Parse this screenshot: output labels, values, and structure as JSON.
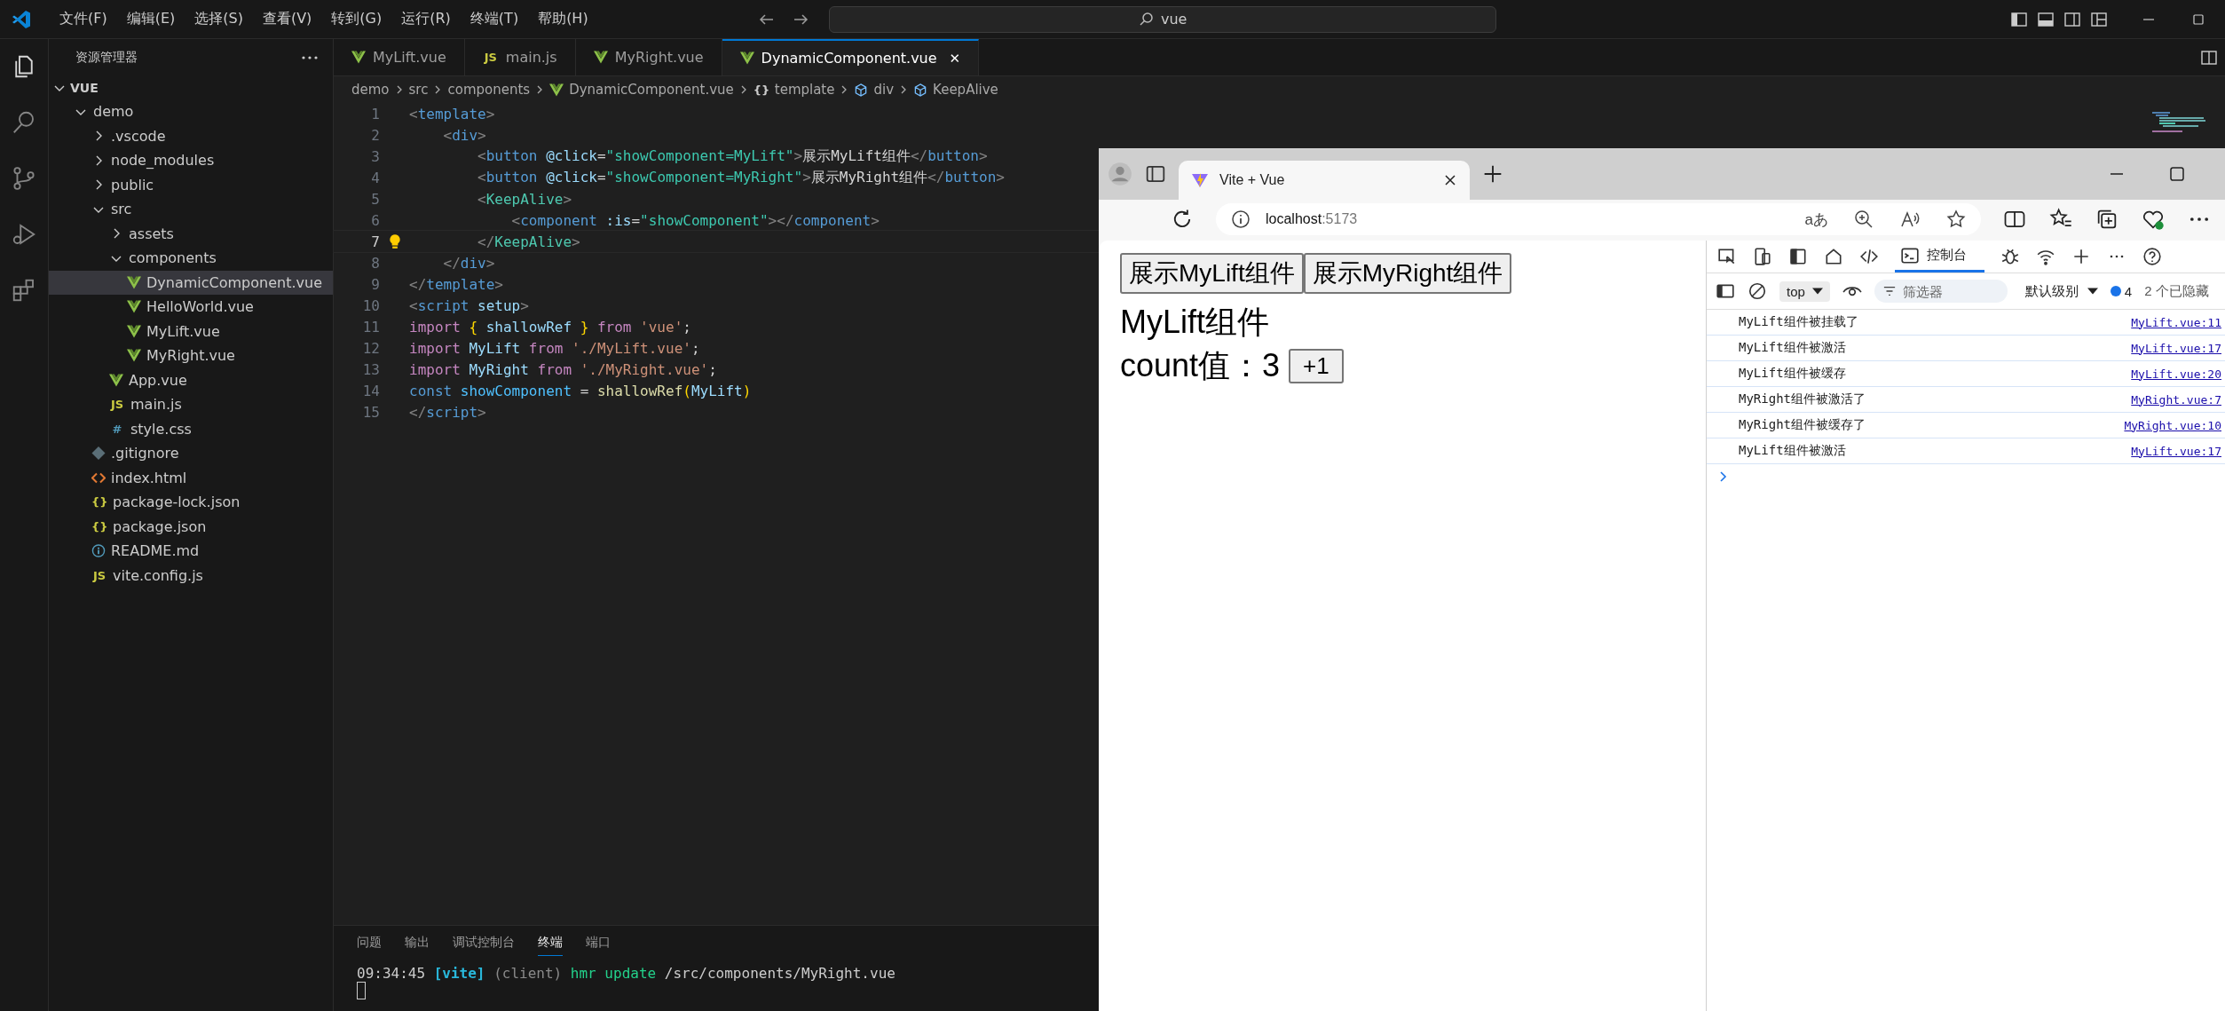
{
  "menu": [
    "文件(F)",
    "编辑(E)",
    "选择(S)",
    "查看(V)",
    "转到(G)",
    "运行(R)",
    "终端(T)",
    "帮助(H)"
  ],
  "command_center": {
    "value": "vue"
  },
  "activity_bar": [
    {
      "kind": "files",
      "selected": true
    },
    {
      "kind": "search",
      "selected": false
    },
    {
      "kind": "source-control",
      "selected": false
    },
    {
      "kind": "debug",
      "selected": false
    },
    {
      "kind": "extensions",
      "selected": false
    }
  ],
  "sidebar": {
    "title": "资源管理器",
    "root": "VUE",
    "tree": [
      {
        "label": "demo",
        "kind": "folder",
        "expanded": true,
        "selected": false,
        "children": [
          {
            "label": ".vscode",
            "kind": "folder",
            "expanded": false,
            "selected": false
          },
          {
            "label": "node_modules",
            "kind": "folder",
            "expanded": false,
            "selected": false
          },
          {
            "label": "public",
            "kind": "folder",
            "expanded": false,
            "selected": false
          },
          {
            "label": "src",
            "kind": "folder",
            "expanded": true,
            "selected": false,
            "children": [
              {
                "label": "assets",
                "kind": "folder",
                "expanded": false,
                "selected": false
              },
              {
                "label": "components",
                "kind": "folder",
                "expanded": true,
                "selected": false,
                "children": [
                  {
                    "label": "DynamicComponent.vue",
                    "kind": "vue",
                    "selected": true
                  },
                  {
                    "label": "HelloWorld.vue",
                    "kind": "vue",
                    "selected": false
                  },
                  {
                    "label": "MyLift.vue",
                    "kind": "vue",
                    "selected": false
                  },
                  {
                    "label": "MyRight.vue",
                    "kind": "vue",
                    "selected": false
                  }
                ]
              },
              {
                "label": "App.vue",
                "kind": "vue",
                "selected": false
              },
              {
                "label": "main.js",
                "kind": "js",
                "badge": "JS",
                "selected": false
              },
              {
                "label": "style.css",
                "kind": "css",
                "badge": "#",
                "selected": false
              }
            ]
          },
          {
            "label": ".gitignore",
            "kind": "git",
            "selected": false
          },
          {
            "label": "index.html",
            "kind": "html",
            "selected": false
          },
          {
            "label": "package-lock.json",
            "kind": "json",
            "badge": "{}",
            "selected": false
          },
          {
            "label": "package.json",
            "kind": "json",
            "badge": "{}",
            "selected": false
          },
          {
            "label": "README.md",
            "kind": "info",
            "selected": false
          },
          {
            "label": "vite.config.js",
            "kind": "js",
            "badge": "JS",
            "selected": false
          }
        ]
      }
    ]
  },
  "tabs": [
    {
      "label": "MyLift.vue",
      "kind": "vue",
      "selected": false
    },
    {
      "label": "main.js",
      "kind": "js",
      "badge": "JS",
      "selected": false
    },
    {
      "label": "MyRight.vue",
      "kind": "vue",
      "selected": false
    },
    {
      "label": "DynamicComponent.vue",
      "kind": "vue",
      "selected": true,
      "close": "✕"
    }
  ],
  "breadcrumb": [
    {
      "label": "demo",
      "kind": "text"
    },
    {
      "label": "src",
      "kind": "text"
    },
    {
      "label": "components",
      "kind": "text"
    },
    {
      "label": "DynamicComponent.vue",
      "kind": "vue"
    },
    {
      "label": "template",
      "kind": "object",
      "badge": "{}"
    },
    {
      "label": "div",
      "kind": "cube"
    },
    {
      "label": "KeepAlive",
      "kind": "cube"
    }
  ],
  "code": [
    {
      "number": "1",
      "current": false,
      "tokens": [
        {
          "kind": "p",
          "text": "<"
        },
        {
          "kind": "tag",
          "text": "template"
        },
        {
          "kind": "p",
          "text": ">"
        }
      ]
    },
    {
      "number": "2",
      "current": false,
      "tokens": [
        {
          "kind": "p",
          "text": "    <"
        },
        {
          "kind": "tag",
          "text": "div"
        },
        {
          "kind": "p",
          "text": ">"
        }
      ]
    },
    {
      "number": "3",
      "current": false,
      "tokens": [
        {
          "kind": "p",
          "text": "        <"
        },
        {
          "kind": "tag",
          "text": "button"
        },
        {
          "kind": "attr",
          "text": " @click"
        },
        {
          "kind": "plain",
          "text": "="
        },
        {
          "kind": "expr",
          "text": "\"showComponent=MyLift\""
        },
        {
          "kind": "p",
          "text": ">"
        },
        {
          "kind": "plain",
          "text": "展示MyLift组件"
        },
        {
          "kind": "p",
          "text": "</"
        },
        {
          "kind": "tag",
          "text": "button"
        },
        {
          "kind": "p",
          "text": ">"
        }
      ]
    },
    {
      "number": "4",
      "current": false,
      "tokens": [
        {
          "kind": "p",
          "text": "        <"
        },
        {
          "kind": "tag",
          "text": "button"
        },
        {
          "kind": "attr",
          "text": " @click"
        },
        {
          "kind": "plain",
          "text": "="
        },
        {
          "kind": "expr",
          "text": "\"showComponent=MyRight\""
        },
        {
          "kind": "p",
          "text": ">"
        },
        {
          "kind": "plain",
          "text": "展示MyRight组件"
        },
        {
          "kind": "p",
          "text": "</"
        },
        {
          "kind": "tag",
          "text": "button"
        },
        {
          "kind": "p",
          "text": ">"
        }
      ]
    },
    {
      "number": "5",
      "current": false,
      "tokens": [
        {
          "kind": "p",
          "text": "        <"
        },
        {
          "kind": "comp",
          "text": "KeepAlive"
        },
        {
          "kind": "p",
          "text": ">"
        }
      ]
    },
    {
      "number": "6",
      "current": false,
      "tokens": [
        {
          "kind": "p",
          "text": "            <"
        },
        {
          "kind": "tag",
          "text": "component"
        },
        {
          "kind": "attr",
          "text": " :is"
        },
        {
          "kind": "plain",
          "text": "="
        },
        {
          "kind": "expr",
          "text": "\"showComponent\""
        },
        {
          "kind": "p",
          "text": "></"
        },
        {
          "kind": "tag",
          "text": "component"
        },
        {
          "kind": "p",
          "text": ">"
        }
      ]
    },
    {
      "number": "7",
      "current": true,
      "tokens": [
        {
          "kind": "p",
          "text": "        </"
        },
        {
          "kind": "comp",
          "text": "KeepAlive"
        },
        {
          "kind": "p",
          "text": ">"
        }
      ]
    },
    {
      "number": "8",
      "current": false,
      "tokens": [
        {
          "kind": "p",
          "text": "    </"
        },
        {
          "kind": "tag",
          "text": "div"
        },
        {
          "kind": "p",
          "text": ">"
        }
      ]
    },
    {
      "number": "9",
      "current": false,
      "tokens": [
        {
          "kind": "p",
          "text": "</"
        },
        {
          "kind": "tag",
          "text": "template"
        },
        {
          "kind": "p",
          "text": ">"
        }
      ]
    },
    {
      "number": "10",
      "current": false,
      "tokens": [
        {
          "kind": "p",
          "text": "<"
        },
        {
          "kind": "tag",
          "text": "script"
        },
        {
          "kind": "attr",
          "text": " setup"
        },
        {
          "kind": "p",
          "text": ">"
        }
      ]
    },
    {
      "number": "11",
      "current": false,
      "tokens": [
        {
          "kind": "kw",
          "text": "import "
        },
        {
          "kind": "brace",
          "text": "{ "
        },
        {
          "kind": "var",
          "text": "shallowRef"
        },
        {
          "kind": "brace",
          "text": " }"
        },
        {
          "kind": "kw",
          "text": " from "
        },
        {
          "kind": "str",
          "text": "'vue'"
        },
        {
          "kind": "plain",
          "text": ";"
        }
      ]
    },
    {
      "number": "12",
      "current": false,
      "tokens": [
        {
          "kind": "kw",
          "text": "import "
        },
        {
          "kind": "var",
          "text": "MyLift"
        },
        {
          "kind": "kw",
          "text": " from "
        },
        {
          "kind": "str",
          "text": "'./MyLift.vue'"
        },
        {
          "kind": "plain",
          "text": ";"
        }
      ]
    },
    {
      "number": "13",
      "current": false,
      "tokens": [
        {
          "kind": "kw",
          "text": "import "
        },
        {
          "kind": "var",
          "text": "MyRight"
        },
        {
          "kind": "kw",
          "text": " from "
        },
        {
          "kind": "str",
          "text": "'./MyRight.vue'"
        },
        {
          "kind": "plain",
          "text": ";"
        }
      ]
    },
    {
      "number": "14",
      "current": false,
      "tokens": [
        {
          "kind": "tag",
          "text": "const "
        },
        {
          "kind": "const",
          "text": "showComponent"
        },
        {
          "kind": "plain",
          "text": " = "
        },
        {
          "kind": "fn",
          "text": "shallowRef"
        },
        {
          "kind": "brace",
          "text": "("
        },
        {
          "kind": "var",
          "text": "MyLift"
        },
        {
          "kind": "brace",
          "text": ")"
        }
      ]
    },
    {
      "number": "15",
      "current": false,
      "tokens": [
        {
          "kind": "p",
          "text": "</"
        },
        {
          "kind": "tag",
          "text": "script"
        },
        {
          "kind": "p",
          "text": ">"
        }
      ]
    }
  ],
  "panel": {
    "tabs": [
      {
        "label": "问题",
        "selected": false
      },
      {
        "label": "输出",
        "selected": false
      },
      {
        "label": "调试控制台",
        "selected": false
      },
      {
        "label": "终端",
        "selected": true
      },
      {
        "label": "端口",
        "selected": false
      }
    ],
    "terminal": [
      {
        "kind": "plain",
        "text": "09:34:45 "
      },
      {
        "kind": "vite",
        "text": "[vite]"
      },
      {
        "kind": "dim",
        "text": " (client)"
      },
      {
        "kind": "green",
        "text": " hmr update"
      },
      {
        "kind": "plain",
        "text": " /src/components/MyRight.vue"
      }
    ]
  },
  "browser": {
    "tab_title": "Vite + Vue",
    "address": {
      "host": "localhost",
      "port": ":5173"
    },
    "translate": "aあ",
    "page": {
      "buttons": [
        "展示MyLift组件",
        "展示MyRight组件"
      ],
      "heading": "MyLift组件",
      "count_label": "count值：3",
      "increment": "+1"
    },
    "devtools": {
      "tabs": [
        {
          "kind": "inspect",
          "selected": false
        },
        {
          "kind": "device",
          "selected": false
        },
        {
          "kind": "dock",
          "selected": false
        },
        {
          "kind": "home",
          "selected": false
        },
        {
          "kind": "elements",
          "selected": false
        },
        {
          "kind": "console",
          "label": "控制台",
          "selected": true
        },
        {
          "kind": "bug",
          "selected": false
        },
        {
          "kind": "network",
          "selected": false
        },
        {
          "kind": "add",
          "selected": false
        },
        {
          "kind": "more",
          "selected": false
        },
        {
          "kind": "help",
          "selected": false
        }
      ],
      "context": "top",
      "filter_placeholder": "筛选器",
      "level": "默认级别",
      "issues": "4",
      "hidden": "2 个已隐藏",
      "messages": [
        {
          "text": "MyLift组件被挂载了",
          "source": "MyLift.vue:11"
        },
        {
          "text": "MyLift组件被激活",
          "source": "MyLift.vue:17"
        },
        {
          "text": "MyLift组件被缓存",
          "source": "MyLift.vue:20"
        },
        {
          "text": "MyRight组件被激活了",
          "source": "MyRight.vue:7"
        },
        {
          "text": "MyRight组件被缓存了",
          "source": "MyRight.vue:10"
        },
        {
          "text": "MyLift组件被激活",
          "source": "MyLift.vue:17"
        }
      ]
    }
  }
}
